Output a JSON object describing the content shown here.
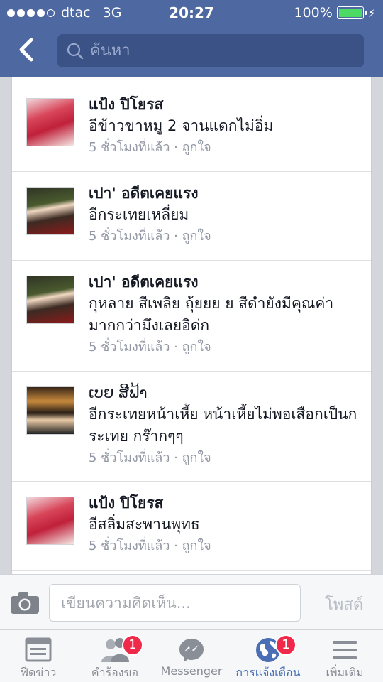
{
  "status_bar": {
    "carrier": "dtac",
    "network": "3G",
    "time": "20:27",
    "battery": "100%"
  },
  "header": {
    "back_icon": "chevron-left-icon",
    "search_placeholder": "ค้นหา"
  },
  "notifications": [
    {
      "name": "แป้ง ปิโยรส",
      "bold": true,
      "text": "อีข้าวขาหมู 2 จานแดกไม่อิ่ม",
      "meta": "5 ชั่วโมงที่แล้ว · ถูกใจ",
      "avatar": "av-red"
    },
    {
      "name": "เปา' อดีตเคยแรง",
      "bold": true,
      "text": "อีกระเทยเหลี่ยม",
      "meta": "5 ชั่วโมงที่แล้ว · ถูกใจ",
      "avatar": "av-green"
    },
    {
      "name": "เปา' อดีตเคยแรง",
      "bold": true,
      "text": "กุหลาย สีเพลิย ถุ้ยยย ย สีดำยังมีคุณค่ามากกว่ามึงเลยอิด่ก",
      "meta": "5 ชั่วโมงที่แล้ว · ถูกใจ",
      "avatar": "av-green"
    },
    {
      "name": "ເບຍ ສີຟ້າ",
      "bold": false,
      "text": "อีกระเทยหน้าเหี้ย หน้าเหี้ยไม่พอเสือกเป็นกระเทย กร๊ากๆๆ",
      "meta": "5 ชั่วโมงที่แล้ว · ถูกใจ",
      "avatar": "av-night"
    },
    {
      "name": "แป้ง ปิโยรส",
      "bold": true,
      "text": "อีสลิ่มสะพานพุทธ",
      "meta": "5 ชั่วโมงที่แล้ว · ถูกใจ",
      "avatar": "av-red"
    }
  ],
  "comment_bar": {
    "placeholder": "เขียนความคิดเห็น...",
    "post_label": "โพสต์"
  },
  "tabs": [
    {
      "label": "ฟีดข่าว",
      "icon": "news-feed-icon",
      "badge": "",
      "active": false
    },
    {
      "label": "คำร้องขอ",
      "icon": "friend-requests-icon",
      "badge": "1",
      "active": false
    },
    {
      "label": "Messenger",
      "icon": "messenger-icon",
      "badge": "",
      "active": false
    },
    {
      "label": "การแจ้งเตือน",
      "icon": "globe-icon",
      "badge": "1",
      "active": true
    },
    {
      "label": "เพิ่มเติม",
      "icon": "menu-icon",
      "badge": "",
      "active": false
    }
  ]
}
